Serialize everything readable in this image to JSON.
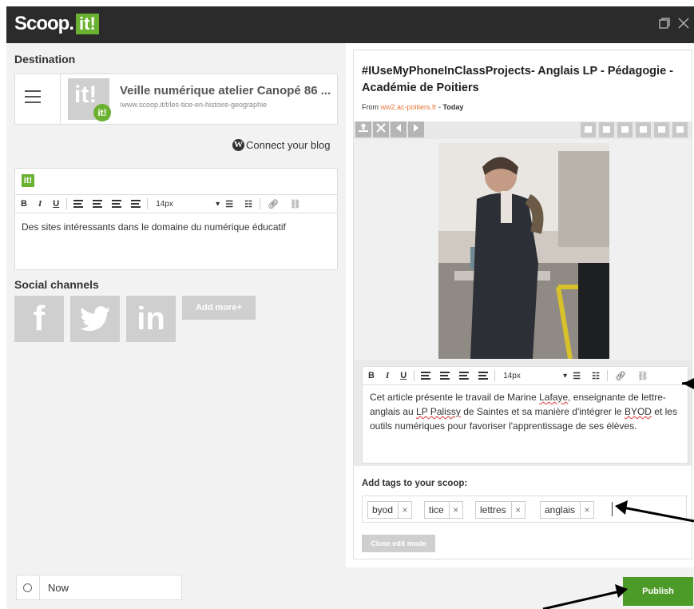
{
  "header": {
    "logo_text": "Scoop.",
    "logo_box": "it!",
    "maximize_icon": "maximize-icon",
    "close_icon": "close-icon"
  },
  "destination": {
    "heading": "Destination",
    "thumb_text": "it!",
    "thumb_badge": "it!",
    "title": "Veille numérique atelier Canopé 86 ...",
    "url": "/www.scoop.it/t/les-tice-en-histoire-geographie",
    "connect_blog": "Connect your blog",
    "connect_icon": "wordpress-icon"
  },
  "left_editor": {
    "badge": "it!",
    "font_size": "14px",
    "text": "Des sites intéressants dans le domaine du numérique éducatif"
  },
  "social": {
    "heading": "Social channels",
    "facebook": "f",
    "twitter_icon": "twitter-icon",
    "linkedin": "in",
    "add_more": "Add more+"
  },
  "article": {
    "title": "#IUseMyPhoneInClassProjects- Anglais LP - Pédagogie - Académie de Poitiers",
    "from_label": "From ",
    "source": "ww2.ac-poitiers.fr",
    "date_sep": " - ",
    "date": "Today",
    "text_parts": [
      "Cet article présente le travail de Marine ",
      "Lafaye",
      ", enseignante de lettre-anglais au ",
      "LP Palissy",
      " de Saintes et sa manière d'intégrer le ",
      "BYOD",
      " et les outils numériques pour favoriser l'apprentissage de ses élèves."
    ]
  },
  "right_editor": {
    "font_size": "14px"
  },
  "toolbar": {
    "bold": "B",
    "italic": "I",
    "underline": "U"
  },
  "tags": {
    "heading": "Add tags to your scoop:",
    "items": [
      "byod",
      "tice",
      "lettres",
      "anglais"
    ],
    "remove": "×"
  },
  "close_edit": "Close edit mode",
  "footer": {
    "time_value": "Now",
    "publish": "Publish"
  },
  "colors": {
    "brand_green": "#6bb131",
    "publish_green": "#4c9a28",
    "source_link": "#e8763a",
    "header_bg": "#2b2b2b"
  }
}
